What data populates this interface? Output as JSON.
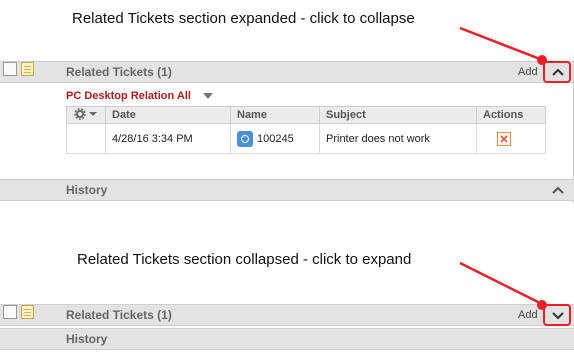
{
  "annotations": {
    "expanded": "Related Tickets section expanded - click to collapse",
    "collapsed": "Related Tickets section collapsed - click to expand"
  },
  "expanded_panel": {
    "section_title": "Related Tickets (1)",
    "add_label": "Add",
    "relation_title": "PC Desktop Relation All",
    "columns": [
      "Date",
      "Name",
      "Subject",
      "Actions"
    ],
    "row": {
      "date": "4/28/16 3:34 PM",
      "name": "100245",
      "subject": "Printer does not work"
    },
    "history_title": "History"
  },
  "collapsed_panel": {
    "section_title": "Related Tickets (1)",
    "add_label": "Add",
    "history_title": "History"
  },
  "colors": {
    "arrow": "#e8202a",
    "relation_title": "#a52020"
  },
  "icons": [
    "checkbox-icon",
    "note-icon",
    "gear-icon",
    "chevron-up-icon",
    "chevron-down-icon",
    "ticket-icon",
    "delete-icon"
  ]
}
